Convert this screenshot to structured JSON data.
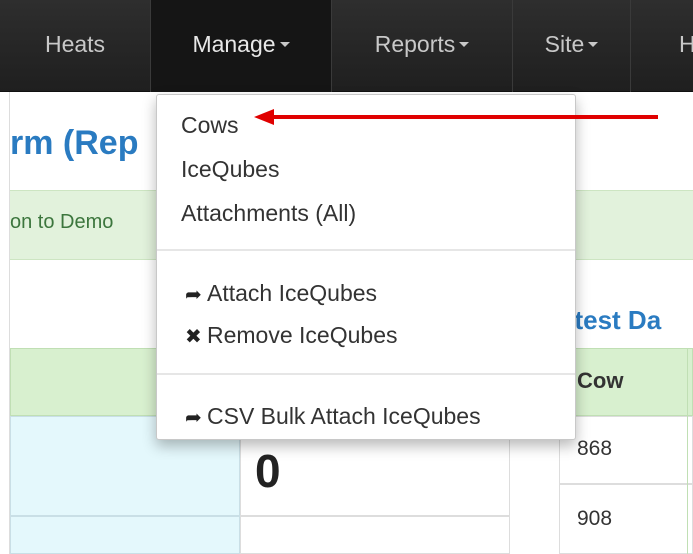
{
  "navbar": {
    "items": [
      {
        "label": "Heats"
      },
      {
        "label": "Manage"
      },
      {
        "label": "Reports"
      },
      {
        "label": "Site"
      },
      {
        "label": "H"
      }
    ]
  },
  "page": {
    "title": "rm (Rep",
    "alert_text": "on to Demo"
  },
  "manage_menu": {
    "items": [
      {
        "label": "Cows"
      },
      {
        "label": "IceQubes"
      },
      {
        "label": "Attachments (All)"
      },
      {
        "label": "Attach IceQubes",
        "icon": "share-arrow-icon"
      },
      {
        "label": "Remove IceQubes",
        "icon": "remove-x-icon"
      },
      {
        "label": "CSV Bulk Attach IceQubes",
        "icon": "share-arrow-icon"
      }
    ]
  },
  "left_panel": {
    "big_value": "0"
  },
  "latest_data": {
    "title": "atest Da",
    "column_header": "Cow",
    "rows": [
      "868",
      "908"
    ]
  },
  "annotation": {
    "arrow_color": "#e00000"
  }
}
